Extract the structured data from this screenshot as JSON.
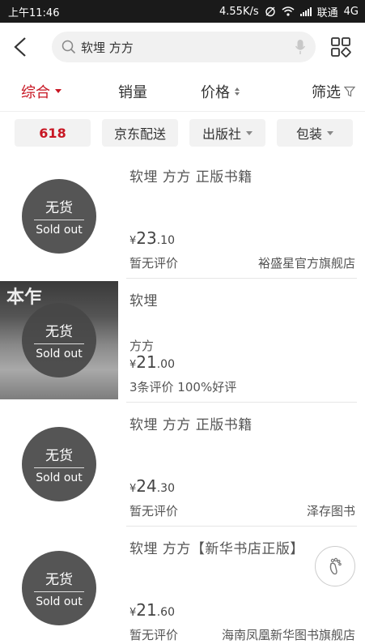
{
  "status_bar": {
    "time": "上午11:46",
    "net_speed": "4.55K/s",
    "carrier": "联通",
    "network": "4G"
  },
  "search": {
    "query": "软埋 方方",
    "icons": {
      "back": "back-arrow-icon",
      "search": "search-icon",
      "mic": "microphone-icon",
      "grid": "grid-view-icon"
    }
  },
  "sort_tabs": [
    {
      "label": "综合",
      "active": true
    },
    {
      "label": "销量"
    },
    {
      "label": "价格"
    },
    {
      "label": "筛选"
    }
  ],
  "filters": [
    {
      "label": "618"
    },
    {
      "label": "京东配送"
    },
    {
      "label": "出版社"
    },
    {
      "label": "包装"
    }
  ],
  "products": [
    {
      "title": "软埋 方方 正版书籍",
      "subtitle": "",
      "stock_zh": "无货",
      "stock_en": "Sold out",
      "price_currency": "¥",
      "price_int": "23",
      "price_dec": ".10",
      "reviews": "暂无评价",
      "shop": "裕盛星官方旗舰店"
    },
    {
      "title": "软埋",
      "subtitle": "方方",
      "stock_zh": "无货",
      "stock_en": "Sold out",
      "price_currency": "¥",
      "price_int": "21",
      "price_dec": ".00",
      "reviews": "3条评价 100%好评",
      "shop": "",
      "cover_text": "本乍"
    },
    {
      "title": "软埋 方方 正版书籍",
      "subtitle": "",
      "stock_zh": "无货",
      "stock_en": "Sold out",
      "price_currency": "¥",
      "price_int": "24",
      "price_dec": ".30",
      "reviews": "暂无评价",
      "shop": "泽存图书"
    },
    {
      "title": "软埋 方方【新华书店正版】",
      "subtitle": "",
      "stock_zh": "无货",
      "stock_en": "Sold out",
      "price_currency": "¥",
      "price_int": "21",
      "price_dec": ".60",
      "reviews": "暂无评价",
      "shop": "海南凤凰新华图书旗舰店"
    }
  ],
  "colors": {
    "accent": "#c81623",
    "sold_out_bg": "#464646"
  }
}
